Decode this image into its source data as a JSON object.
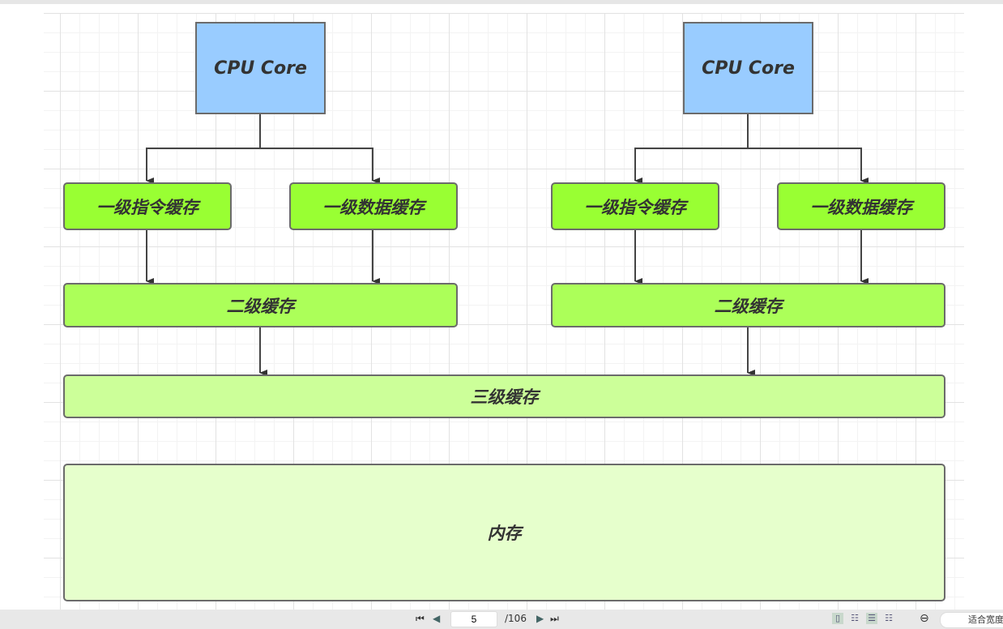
{
  "diagram": {
    "left": {
      "cpu": "CPU Core",
      "l1i": "一级指令缓存",
      "l1d": "一级数据缓存",
      "l2": "二级缓存"
    },
    "right": {
      "cpu": "CPU Core",
      "l1i": "一级指令缓存",
      "l1d": "一级数据缓存",
      "l2": "二级缓存"
    },
    "l3": "三级缓存",
    "memory": "内存",
    "colors": {
      "cpu": "#99ccff",
      "l1": "#99ff33",
      "l2": "#acff59",
      "l3": "#ccff99",
      "memory": "#e6ffcc"
    }
  },
  "toolbar": {
    "current_page": "5",
    "total_pages": "/106",
    "zoom_label": "适合宽度"
  }
}
